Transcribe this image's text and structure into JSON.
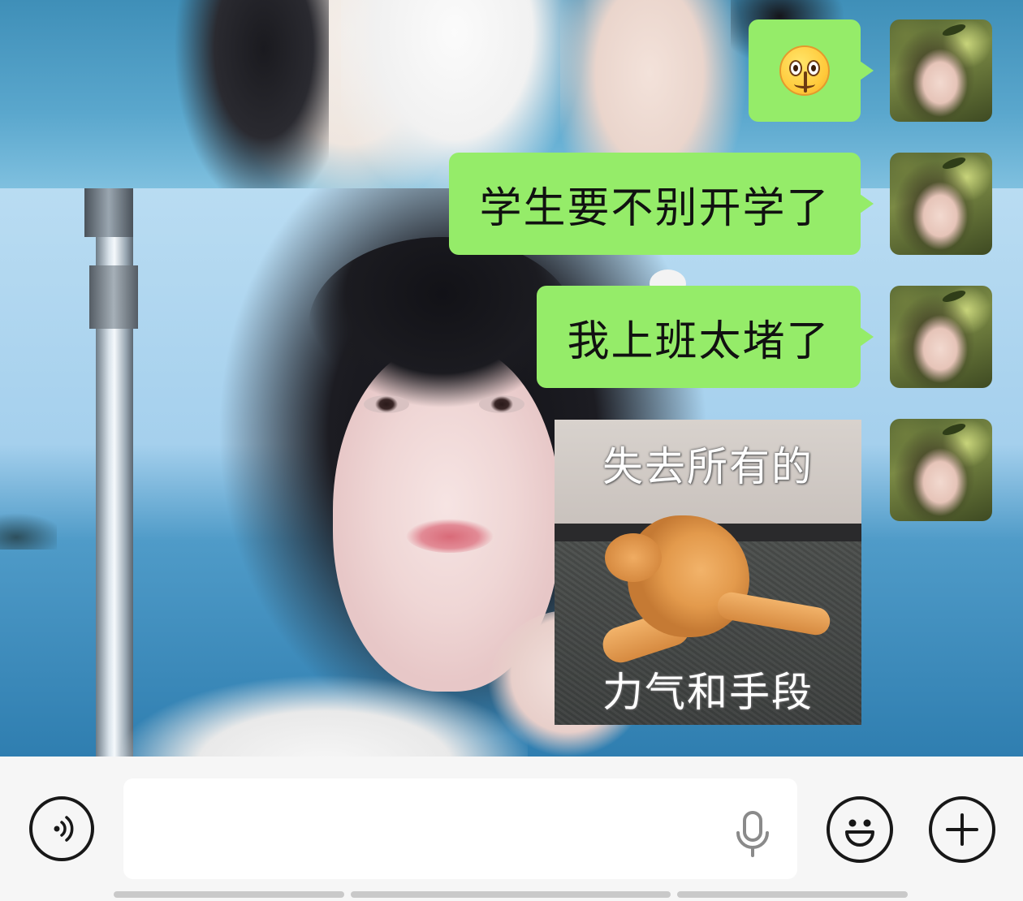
{
  "messages": [
    {
      "type": "emoji",
      "sender": "me",
      "emoji_name": "zipper-mouth-face-emoji"
    },
    {
      "type": "text",
      "sender": "me",
      "text": "学生要不别开学了"
    },
    {
      "type": "text",
      "sender": "me",
      "text": "我上班太堵了"
    },
    {
      "type": "sticker",
      "sender": "me",
      "caption_top": "失去所有的",
      "caption_bottom": "力气和手段",
      "sticker_name": "orange-cat-lying-on-floor"
    }
  ],
  "input_bar": {
    "voice_icon": "voice-mode-icon",
    "text_value": "",
    "mic_icon": "microphone-icon",
    "emoji_icon": "smiley-face-icon",
    "plus_icon": "plus-icon"
  },
  "colors": {
    "bubble": "#95ec69",
    "input_bar_bg": "#f6f6f6",
    "text_field_bg": "#ffffff",
    "icon_stroke": "#181818"
  }
}
